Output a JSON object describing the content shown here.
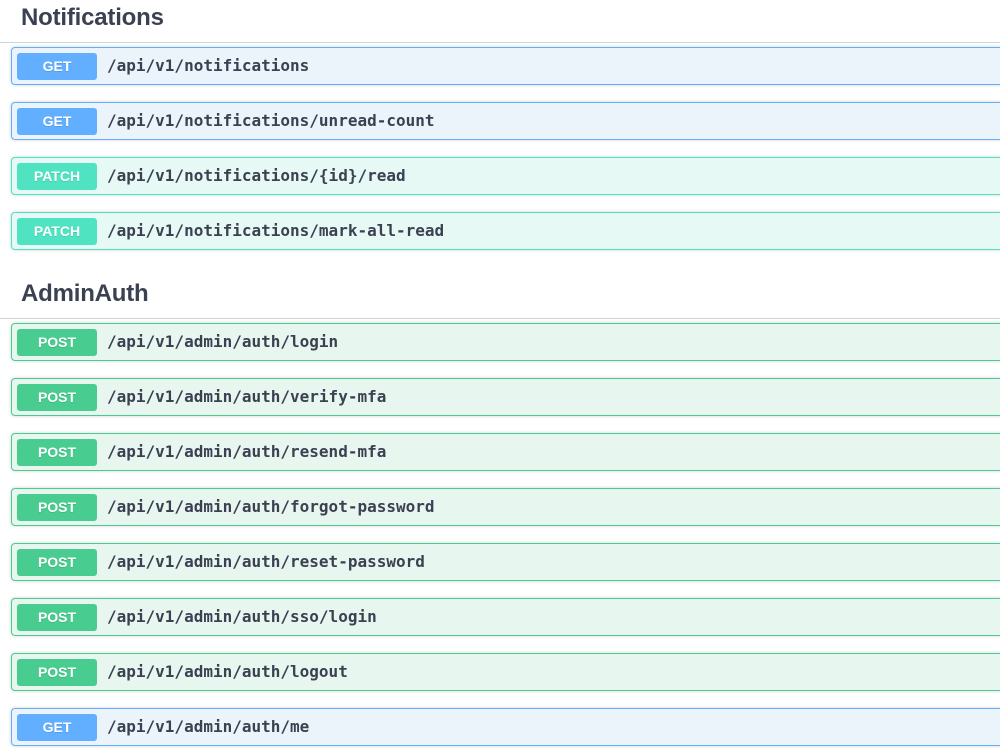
{
  "colors": {
    "get": "#61affe",
    "patch": "#50e3c2",
    "post": "#49cc90",
    "text": "#3b4151"
  },
  "sections": [
    {
      "title": "Notifications",
      "operations": [
        {
          "method": "GET",
          "path": "/api/v1/notifications"
        },
        {
          "method": "GET",
          "path": "/api/v1/notifications/unread-count"
        },
        {
          "method": "PATCH",
          "path": "/api/v1/notifications/{id}/read"
        },
        {
          "method": "PATCH",
          "path": "/api/v1/notifications/mark-all-read"
        }
      ]
    },
    {
      "title": "AdminAuth",
      "operations": [
        {
          "method": "POST",
          "path": "/api/v1/admin/auth/login"
        },
        {
          "method": "POST",
          "path": "/api/v1/admin/auth/verify-mfa"
        },
        {
          "method": "POST",
          "path": "/api/v1/admin/auth/resend-mfa"
        },
        {
          "method": "POST",
          "path": "/api/v1/admin/auth/forgot-password"
        },
        {
          "method": "POST",
          "path": "/api/v1/admin/auth/reset-password"
        },
        {
          "method": "POST",
          "path": "/api/v1/admin/auth/sso/login"
        },
        {
          "method": "POST",
          "path": "/api/v1/admin/auth/logout"
        },
        {
          "method": "GET",
          "path": "/api/v1/admin/auth/me"
        }
      ]
    }
  ]
}
